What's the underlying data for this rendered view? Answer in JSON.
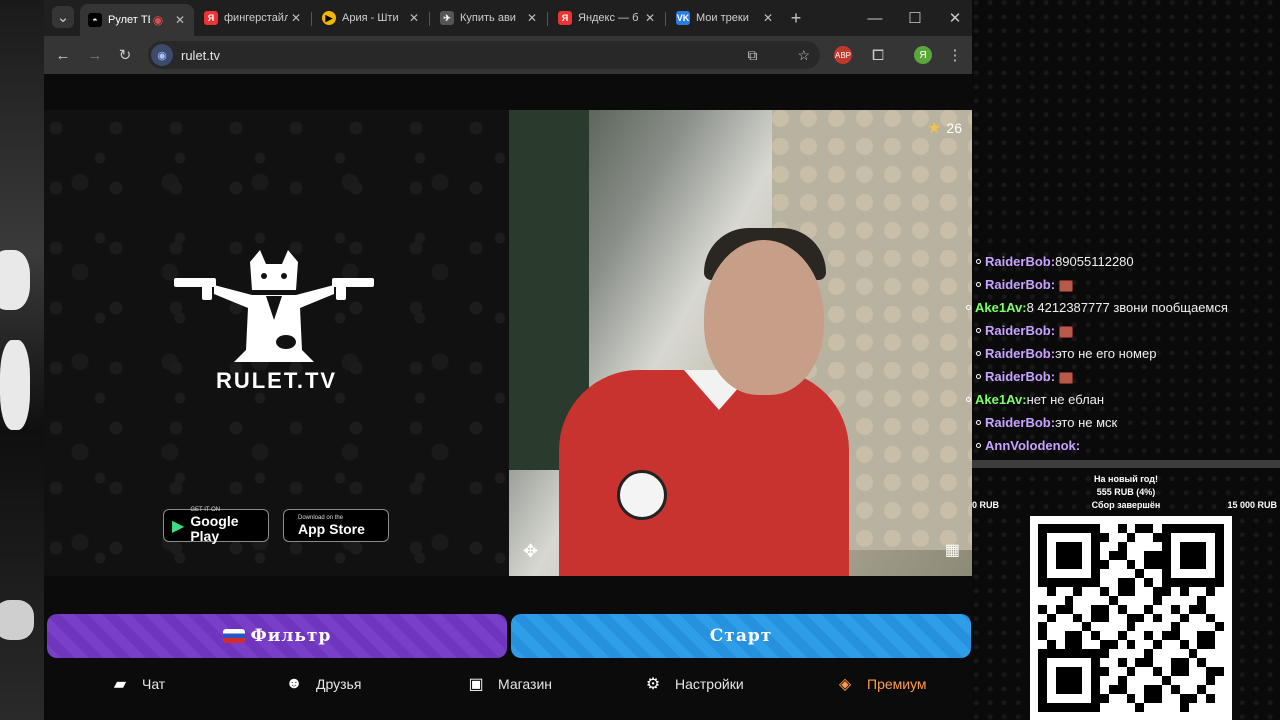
{
  "tabs": [
    {
      "title": "Рулет ТВ",
      "favicon": "rulet-icon",
      "active": true
    },
    {
      "title": "фингерстайл",
      "favicon": "yandex-icon",
      "active": false
    },
    {
      "title": "Ария - Шти",
      "favicon": "play-icon",
      "active": false
    },
    {
      "title": "Купить ави",
      "favicon": "aviasales-icon",
      "active": false
    },
    {
      "title": "Яндекс — б",
      "favicon": "yandex-icon",
      "active": false
    },
    {
      "title": "Мои треки",
      "favicon": "vk-icon",
      "active": false
    }
  ],
  "toolbar": {
    "url": "rulet.tv",
    "extension_badge": "ABP",
    "profile_letter": "Я"
  },
  "page": {
    "brand_name": "RULET.TV",
    "google_play": {
      "small": "GET IT ON",
      "big": "Google Play"
    },
    "app_store": {
      "small": "Download on the",
      "big": "App Store"
    },
    "star_count": "26",
    "filter_label": "Фильтр",
    "start_label": "Старт",
    "nav": [
      {
        "label": "Чат",
        "icon": "chat-icon"
      },
      {
        "label": "Друзья",
        "icon": "friends-icon"
      },
      {
        "label": "Магазин",
        "icon": "shop-bag-icon"
      },
      {
        "label": "Настройки",
        "icon": "gear-icon"
      },
      {
        "label": "Премиум",
        "icon": "tag-icon"
      }
    ]
  },
  "stream_chat": [
    {
      "user": "RaiderBob",
      "text": "89055112280",
      "emote": false,
      "color": "#c9a3ff"
    },
    {
      "user": "RaiderBob",
      "text": "",
      "emote": true,
      "color": "#c9a3ff"
    },
    {
      "user": "Ake1Av",
      "text": "8 4212387777 звони пообщаемся",
      "emote": false,
      "color": "#7dff6a"
    },
    {
      "user": "RaiderBob",
      "text": "",
      "emote": true,
      "color": "#c9a3ff"
    },
    {
      "user": "RaiderBob",
      "text": "это не его номер",
      "emote": false,
      "color": "#c9a3ff"
    },
    {
      "user": "RaiderBob",
      "text": "",
      "emote": true,
      "color": "#c9a3ff"
    },
    {
      "user": "Ake1Av",
      "text": "нет не еблан",
      "emote": false,
      "color": "#7dff6a"
    },
    {
      "user": "RaiderBob",
      "text": "это не мск",
      "emote": false,
      "color": "#c9a3ff"
    },
    {
      "user": "AnnVolodenok",
      "text": "",
      "emote": false,
      "color": "#c9a3ff"
    }
  ],
  "donation_goal": {
    "title": "На новый год!",
    "raised": "555 RUB (4%)",
    "min": "0 RUB",
    "status": "Сбор завершён",
    "max": "15 000 RUB",
    "progress": 0.04
  }
}
